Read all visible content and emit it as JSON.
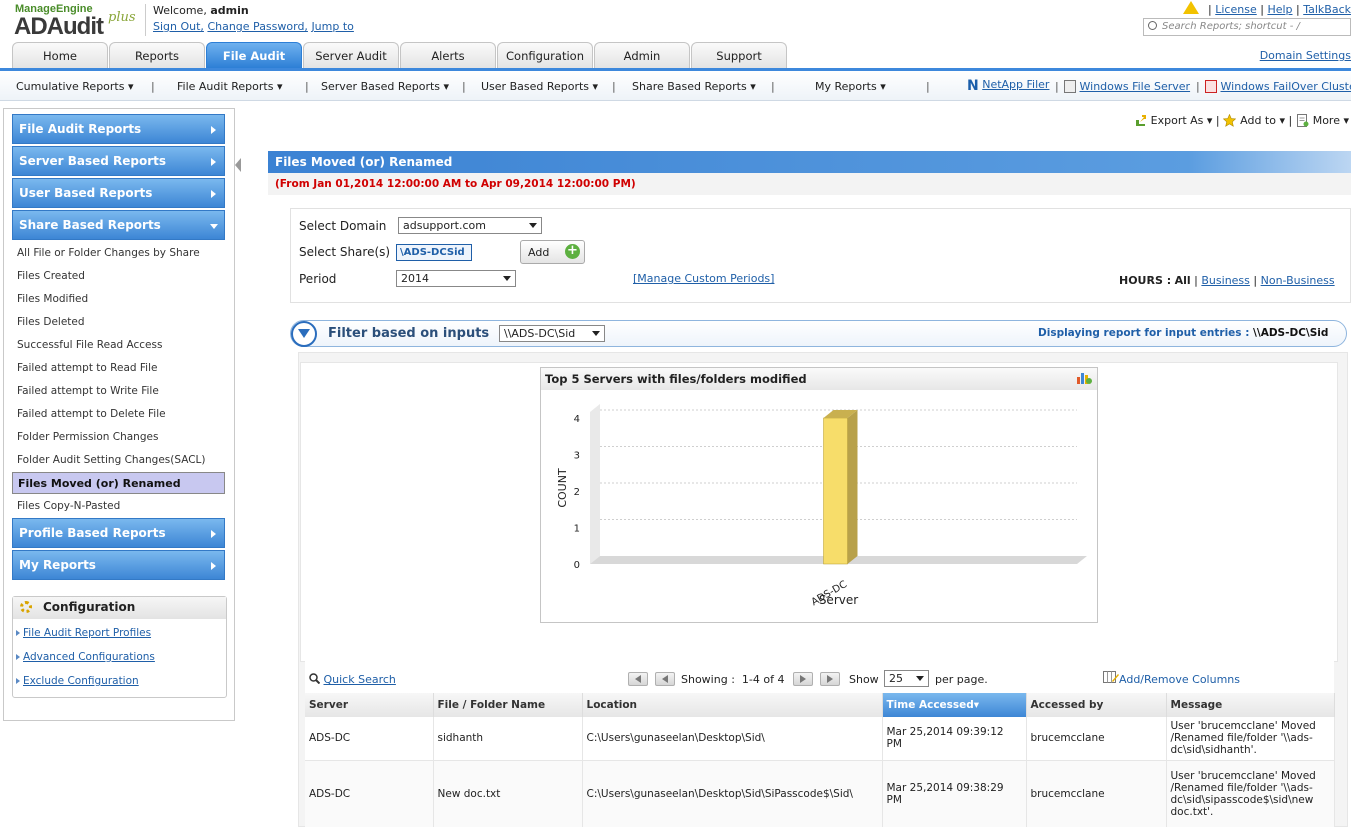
{
  "header": {
    "logo_top": "ManageEngine",
    "logo_main": "ADAudit",
    "logo_plus": "plus",
    "welcome_prefix": "Welcome,",
    "username": "admin",
    "sign_out": "Sign Out,",
    "change_password": "Change Password,",
    "jump_to": "Jump to",
    "license": "License",
    "help": "Help",
    "talkback": "TalkBack",
    "search_placeholder": "Search Reports; shortcut - /",
    "domain_settings": "Domain Settings"
  },
  "tabs": [
    {
      "label": "Home"
    },
    {
      "label": "Reports"
    },
    {
      "label": "File Audit",
      "active": true
    },
    {
      "label": "Server Audit"
    },
    {
      "label": "Alerts"
    },
    {
      "label": "Configuration"
    },
    {
      "label": "Admin"
    },
    {
      "label": "Support"
    }
  ],
  "subnav": {
    "cumulative": "Cumulative Reports ▾",
    "file_audit": "File Audit Reports ▾",
    "server_based": "Server Based Reports ▾",
    "user_based": "User Based Reports ▾",
    "share_based": "Share Based Reports ▾",
    "my_reports": "My Reports ▾",
    "netapp": "NetApp Filer",
    "windows_file_server": "Windows File Server",
    "windows_failover": "Windows FailOver Cluster"
  },
  "sidebar": {
    "sections": {
      "file_audit": "File Audit Reports",
      "server_based": "Server Based Reports",
      "user_based": "User Based Reports",
      "share_based": "Share Based Reports",
      "profile_based": "Profile Based Reports",
      "my_reports": "My Reports"
    },
    "share_items": [
      "All File or Folder Changes by Share",
      "Files Created",
      "Files Modified",
      "Files Deleted",
      "Successful File Read Access",
      "Failed attempt to Read File",
      "Failed attempt to Write File",
      "Failed attempt to Delete File",
      "Folder Permission Changes",
      "Folder Audit Setting Changes(SACL)",
      "Files Moved (or) Renamed",
      "Files Copy-N-Pasted"
    ],
    "selected_item": "Files Moved (or) Renamed",
    "config": {
      "title": "Configuration",
      "links": [
        "File Audit Report Profiles",
        "Advanced Configurations",
        "Exclude Configuration"
      ]
    }
  },
  "toolbar": {
    "export": "Export As ▾",
    "add_to": "Add to ▾",
    "more": "More ▾"
  },
  "report": {
    "title": "Files Moved (or) Renamed",
    "date_range": "(From Jan 01,2014 12:00:00 AM to Apr 09,2014 12:00:00 PM)",
    "select_domain_label": "Select Domain",
    "domain_value": "adsupport.com",
    "select_share_label": "Select Share(s)",
    "share_value": "\\ADS-DCSid",
    "add_button": "Add",
    "period_label": "Period",
    "period_value": "2014",
    "manage_periods": "[Manage Custom Periods]",
    "hours_label": "HOURS :",
    "hours_all": "All",
    "hours_business": "Business",
    "hours_nonbusiness": "Non-Business"
  },
  "filter": {
    "label": "Filter based on inputs",
    "selected": "\\\\ADS-DC\\Sid",
    "displaying_label": "Displaying report for input entries :",
    "displaying_value": "\\\\ADS-DC\\Sid"
  },
  "chart_data": {
    "type": "bar",
    "title": "Top 5 Servers with files/folders modified",
    "categories": [
      "ADS-DC"
    ],
    "values": [
      4
    ],
    "xlabel": "Server",
    "ylabel": "COUNT",
    "ylim": [
      0,
      4
    ],
    "yticks": [
      0,
      1,
      2,
      3,
      4
    ],
    "grid": true,
    "bar_color": "#f7dd6a"
  },
  "table": {
    "quick_search": "Quick Search",
    "showing_label": "Showing :",
    "showing_range": "1-4 of 4",
    "show_label": "Show",
    "page_size": "25",
    "per_page": "per page.",
    "add_remove_columns": "Add/Remove Columns",
    "columns": [
      "Server",
      "File / Folder Name",
      "Location",
      "Time Accessed▾",
      "Accessed by",
      "Message"
    ],
    "rows": [
      {
        "server": "ADS-DC",
        "name": "sidhanth",
        "location": "C:\\Users\\gunaseelan\\Desktop\\Sid\\",
        "time": "Mar 25,2014 09:39:12 PM",
        "accessed_by": "brucemcclane",
        "message": "User 'brucemcclane' Moved /Renamed file/folder '\\\\ads-dc\\sid\\sidhanth'."
      },
      {
        "server": "ADS-DC",
        "name": "New doc.txt",
        "location": "C:\\Users\\gunaseelan\\Desktop\\Sid\\SiPasscode$\\Sid\\",
        "time": "Mar 25,2014 09:38:29 PM",
        "accessed_by": "brucemcclane",
        "message": "User 'brucemcclane' Moved /Renamed file/folder '\\\\ads-dc\\sid\\sipasscode$\\sid\\new doc.txt'."
      }
    ]
  }
}
